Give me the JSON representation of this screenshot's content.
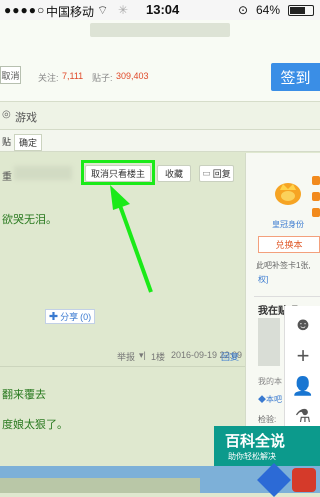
{
  "status": {
    "carrier": "中国移动",
    "time": "13:04",
    "battery": "64%"
  },
  "header": {
    "cancel_label": "取消",
    "follow_label": "关注:",
    "follow_count": "7,111",
    "posts_label": "贴子:",
    "posts_count": "309,403",
    "sign_label": "签到"
  },
  "category": {
    "icon_text": "◎",
    "label": "游戏"
  },
  "subtabs": [
    {
      "label": "贴"
    },
    {
      "label": "确定"
    }
  ],
  "post": {
    "title_fragment": "重",
    "cancel_only_label": "取消只看楼主",
    "collect_label": "收藏",
    "reply_label": "回复",
    "body_line1": "欲哭无泪。",
    "share_label": "分享",
    "share_count": "(0)",
    "report_label": "举报",
    "floor": "1楼",
    "datetime": "2016-09-19 22:09",
    "reply_link": "回复",
    "line2": "翻来覆去",
    "line3": "度娘太狠了。"
  },
  "sidebar": {
    "badge_label": "皇冠身份",
    "exchange_label": "兑换本",
    "signin_hint": "此吧补签卡1张,",
    "privilege_label": "权]",
    "in_bar_label": "我在贴吧",
    "mine_label": "我的本",
    "mine_label2": "◆本吧",
    "check_label": "检验:"
  },
  "banner": {
    "title": "百科全说",
    "subtitle": "助你轻松解决"
  },
  "colors": {
    "accent_green": "#1bea18",
    "brand_blue": "#3a8ee6"
  }
}
